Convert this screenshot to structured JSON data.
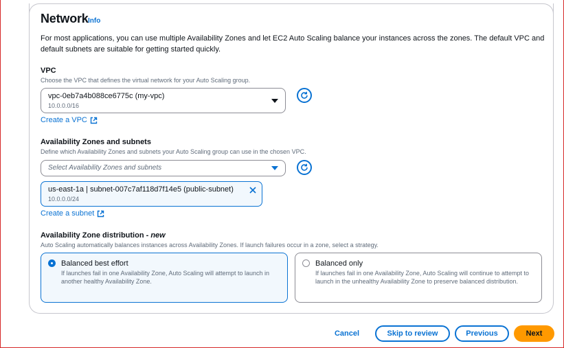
{
  "network": {
    "title": "Network",
    "info": "Info",
    "description": "For most applications, you can use multiple Availability Zones and let EC2 Auto Scaling balance your instances across the zones. The default VPC and default subnets are suitable for getting started quickly."
  },
  "vpc": {
    "label": "VPC",
    "hint": "Choose the VPC that defines the virtual network for your Auto Scaling group.",
    "selected": "vpc-0eb7a4b088ce6775c (my-vpc)",
    "cidr": "10.0.0.0/16",
    "create_link": "Create a VPC"
  },
  "subnets": {
    "label": "Availability Zones and subnets",
    "hint": "Define which Availability Zones and subnets your Auto Scaling group can use in the chosen VPC.",
    "placeholder": "Select Availability Zones and subnets",
    "token_label": "us-east-1a | subnet-007c7af118d7f14e5 (public-subnet)",
    "token_cidr": "10.0.0.0/24",
    "create_link": "Create a subnet"
  },
  "distribution": {
    "label": "Availability Zone distribution",
    "label_new": "new",
    "hint": "Auto Scaling automatically balances instances across Availability Zones. If launch failures occur in a zone, select a strategy.",
    "options": [
      {
        "title": "Balanced best effort",
        "desc": "If launches fail in one Availability Zone, Auto Scaling will attempt to launch in another healthy Availability Zone.",
        "selected": true
      },
      {
        "title": "Balanced only",
        "desc": "If launches fail in one Availability Zone, Auto Scaling will continue to attempt to launch in the unhealthy Availability Zone to preserve balanced distribution.",
        "selected": false
      }
    ]
  },
  "footer": {
    "cancel": "Cancel",
    "skip": "Skip to review",
    "previous": "Previous",
    "next": "Next"
  },
  "colors": {
    "accent": "#0972d3",
    "primary_button": "#ff9900"
  },
  "icons": [
    "refresh-icon",
    "external-link-icon",
    "chevron-down-icon",
    "close-icon"
  ]
}
